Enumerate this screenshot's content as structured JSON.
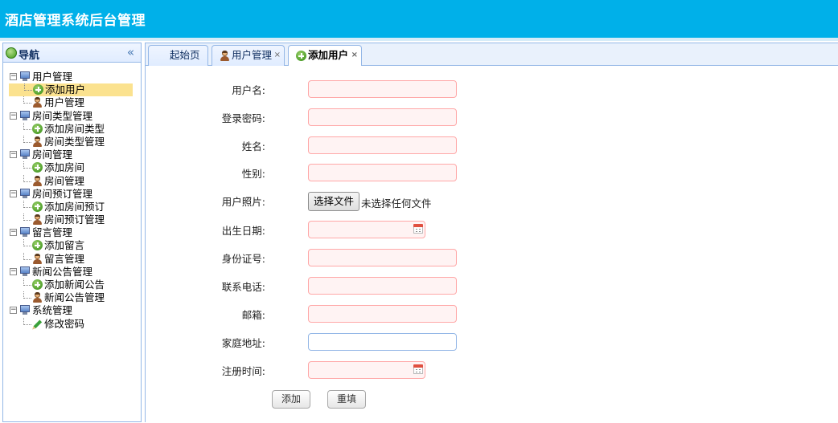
{
  "app": {
    "title": "酒店管理系统后台管理"
  },
  "sidebar": {
    "title": "导航",
    "collapse_glyph": "«",
    "groups": [
      {
        "label": "用户管理",
        "items": [
          {
            "label": "添加用户",
            "icon": "add-icon",
            "selected": true
          },
          {
            "label": "用户管理",
            "icon": "user-icon"
          }
        ]
      },
      {
        "label": "房间类型管理",
        "items": [
          {
            "label": "添加房间类型",
            "icon": "add-icon"
          },
          {
            "label": "房间类型管理",
            "icon": "user-icon"
          }
        ]
      },
      {
        "label": "房间管理",
        "items": [
          {
            "label": "添加房间",
            "icon": "add-icon"
          },
          {
            "label": "房间管理",
            "icon": "user-icon"
          }
        ]
      },
      {
        "label": "房间预订管理",
        "items": [
          {
            "label": "添加房间预订",
            "icon": "add-icon"
          },
          {
            "label": "房间预订管理",
            "icon": "user-icon"
          }
        ]
      },
      {
        "label": "留言管理",
        "items": [
          {
            "label": "添加留言",
            "icon": "add-icon"
          },
          {
            "label": "留言管理",
            "icon": "user-icon"
          }
        ]
      },
      {
        "label": "新闻公告管理",
        "items": [
          {
            "label": "添加新闻公告",
            "icon": "add-icon"
          },
          {
            "label": "新闻公告管理",
            "icon": "user-icon"
          }
        ]
      },
      {
        "label": "系统管理",
        "items": [
          {
            "label": "修改密码",
            "icon": "pencil-icon"
          }
        ]
      }
    ]
  },
  "tabs": [
    {
      "label": "起始页"
    },
    {
      "label": "用户管理",
      "close": "×"
    },
    {
      "label": "添加用户",
      "close": "×",
      "active": true
    }
  ],
  "form": {
    "username_label": "用户名:",
    "password_label": "登录密码:",
    "name_label": "姓名:",
    "gender_label": "性别:",
    "photo_label": "用户照片:",
    "photo_button": "选择文件",
    "photo_status": "未选择任何文件",
    "birthday_label": "出生日期:",
    "idcard_label": "身份证号:",
    "phone_label": "联系电话:",
    "email_label": "邮箱:",
    "address_label": "家庭地址:",
    "regtime_label": "注册时间:",
    "submit_label": "添加",
    "reset_label": "重填"
  },
  "colors": {
    "header": "#00b0e9",
    "invalid_border": "#ffa8a8",
    "invalid_bg": "#fff3f3",
    "selected_row": "#fbe28f"
  }
}
